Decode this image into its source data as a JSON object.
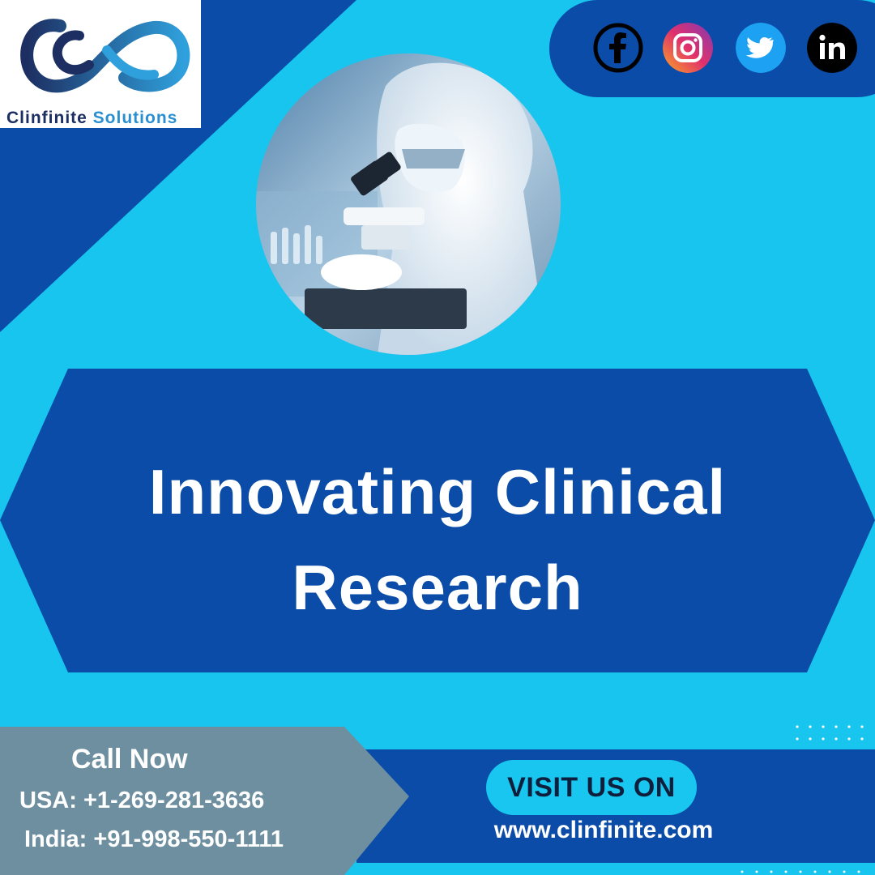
{
  "brand": {
    "name_part1": "Clinfinite",
    "name_part2": "Solutions",
    "colors": {
      "dark_blue": "#0a4ca8",
      "light_blue": "#18c6ef",
      "navy": "#1d2f62",
      "slate": "#6d8fa0"
    }
  },
  "social": [
    {
      "name": "facebook-icon",
      "color": "#1877f2"
    },
    {
      "name": "instagram-icon",
      "color": "#e1306c"
    },
    {
      "name": "twitter-icon",
      "color": "#1da1f2"
    },
    {
      "name": "linkedin-icon",
      "color": "#000000"
    }
  ],
  "headline": {
    "line1": "Innovating Clinical",
    "line2": "Research"
  },
  "contact": {
    "heading": "Call Now",
    "usa": "USA: +1-269-281-3636",
    "india": "India: +91-998-550-1111"
  },
  "visit": {
    "label": "VISIT US ON",
    "url": "www.clinfinite.com"
  }
}
